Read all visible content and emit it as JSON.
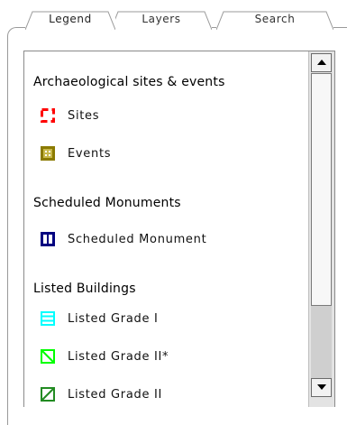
{
  "tabs": [
    {
      "label": "Legend",
      "active": true
    },
    {
      "label": "Layers",
      "active": false
    },
    {
      "label": "Search",
      "active": false
    }
  ],
  "sections": [
    {
      "heading": "Archaeological sites & events",
      "items": [
        {
          "label": "Sites",
          "symbol": "dashed-square-icon",
          "color": "#ff0000"
        },
        {
          "label": "Events",
          "symbol": "dotted-square-icon",
          "color": "#8b7a00"
        }
      ]
    },
    {
      "heading": "Scheduled Monuments",
      "items": [
        {
          "label": "Scheduled Monument",
          "symbol": "vertical-hatched-square-icon",
          "color": "#000080"
        }
      ]
    },
    {
      "heading": "Listed Buildings",
      "items": [
        {
          "label": "Listed Grade I",
          "symbol": "horizontal-hatched-square-icon",
          "color": "#00ffff"
        },
        {
          "label": "Listed Grade II*",
          "symbol": "diagonal-hatched-square-icon",
          "color": "#00ff00"
        },
        {
          "label": "Listed Grade II",
          "symbol": "diagonal-hatched-square-icon",
          "color": "#228b22"
        }
      ]
    }
  ]
}
